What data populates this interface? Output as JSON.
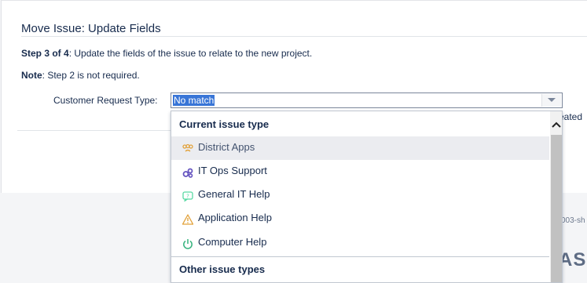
{
  "dialog": {
    "title": "Move Issue: Update Fields",
    "step_prefix": "Step 3 of 4",
    "step_text": ": Update the fields of the issue to relate to the new project.",
    "note_prefix": "Note",
    "note_text": ": Step 2 is not required."
  },
  "form": {
    "customer_request_type_label": "Customer Request Type:",
    "select_value": "No match"
  },
  "side_text": "eated",
  "footer_text": "003-sh",
  "logo_text": "ASS",
  "dropdown": {
    "groups": [
      {
        "heading": "Current issue type",
        "items": [
          {
            "label": "District Apps",
            "icon": "people-icon",
            "color": "#e2a23b"
          },
          {
            "label": "IT Ops Support",
            "icon": "gears-icon",
            "color": "#6554c0"
          },
          {
            "label": "General IT Help",
            "icon": "help-chat-icon",
            "color": "#57d9a3"
          },
          {
            "label": "Application Help",
            "icon": "warning-icon",
            "color": "#e2a23b"
          },
          {
            "label": "Computer Help",
            "icon": "power-icon",
            "color": "#36b37e"
          }
        ]
      },
      {
        "heading": "Other issue types",
        "items": []
      }
    ]
  },
  "colors": {
    "selection": "#3875d7",
    "text": "#172b4d",
    "active_row": "#ebecf0"
  }
}
